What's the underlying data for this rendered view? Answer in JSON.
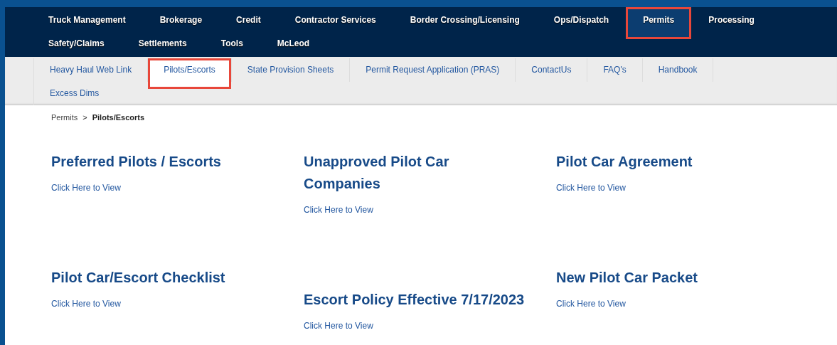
{
  "top_nav": {
    "items": [
      {
        "label": "Truck Management",
        "selected": false,
        "highlighted": false
      },
      {
        "label": "Brokerage",
        "selected": false,
        "highlighted": false
      },
      {
        "label": "Credit",
        "selected": false,
        "highlighted": false
      },
      {
        "label": "Contractor Services",
        "selected": false,
        "highlighted": false
      },
      {
        "label": "Border Crossing/Licensing",
        "selected": false,
        "highlighted": false
      },
      {
        "label": "Ops/Dispatch",
        "selected": false,
        "highlighted": false
      },
      {
        "label": "Permits",
        "selected": true,
        "highlighted": true
      },
      {
        "label": "Processing",
        "selected": false,
        "highlighted": false
      },
      {
        "label": "Safety/Claims",
        "selected": false,
        "highlighted": false
      },
      {
        "label": "Settlements",
        "selected": false,
        "highlighted": false
      },
      {
        "label": "Tools",
        "selected": false,
        "highlighted": false
      },
      {
        "label": "McLeod",
        "selected": false,
        "highlighted": false
      }
    ]
  },
  "sub_nav": {
    "items": [
      {
        "label": "Heavy Haul Web Link",
        "selected": false,
        "highlighted": false
      },
      {
        "label": "Pilots/Escorts",
        "selected": true,
        "highlighted": true
      },
      {
        "label": "State Provision Sheets",
        "selected": false,
        "highlighted": false
      },
      {
        "label": "Permit Request Application (PRAS)",
        "selected": false,
        "highlighted": false
      },
      {
        "label": "ContactUs",
        "selected": false,
        "highlighted": false
      },
      {
        "label": "FAQ's",
        "selected": false,
        "highlighted": false
      },
      {
        "label": "Handbook",
        "selected": false,
        "highlighted": false
      },
      {
        "label": "Excess Dims",
        "selected": false,
        "highlighted": false
      }
    ]
  },
  "breadcrumb": {
    "items": [
      "Permits",
      "Pilots/Escorts"
    ],
    "separator": ">"
  },
  "columns": [
    {
      "sections": [
        {
          "title": "Preferred Pilots / Escorts",
          "link": "Click Here to View"
        },
        {
          "title": "Pilot Car/Escort Checklist",
          "link": "Click Here to View"
        }
      ]
    },
    {
      "sections": [
        {
          "title": "Unapproved Pilot Car Companies",
          "link": "Click Here to View"
        },
        {
          "title": "Escort Policy Effective 7/17/2023",
          "link": "Click Here to View"
        }
      ]
    },
    {
      "sections": [
        {
          "title": "Pilot Car Agreement",
          "link": "Click Here to View"
        },
        {
          "title": "New Pilot Car Packet",
          "link": "Click Here to View"
        }
      ]
    }
  ]
}
